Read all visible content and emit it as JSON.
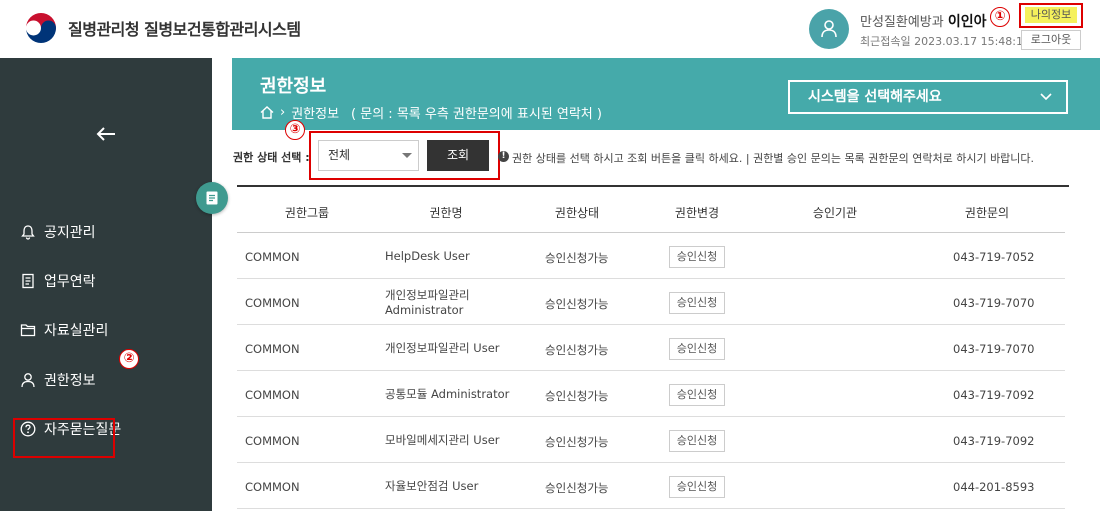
{
  "app": {
    "title": "질병관리청 질병보건통합관리시스템",
    "user_dept": "만성질환예방과",
    "user_name": "이인아",
    "last_login": "최근접속일 2023.03.17 15:48:10",
    "myinfo_label": "나의정보",
    "logout_label": "로그아웃"
  },
  "annotations": {
    "one": "①",
    "two": "②",
    "three": "③"
  },
  "sidebar": {
    "back_icon": "left-arrow-icon",
    "items": [
      {
        "label": "공지관리",
        "icon": "bell-icon"
      },
      {
        "label": "업무연락",
        "icon": "document-icon"
      },
      {
        "label": "자료실관리",
        "icon": "folder-icon"
      },
      {
        "label": "권한정보",
        "icon": "user-icon"
      },
      {
        "label": "자주묻는질문",
        "icon": "question-icon"
      }
    ]
  },
  "main": {
    "title": "권한정보",
    "breadcrumb": "권한정보",
    "breadcrumb_note": "( 문의 : 목록 우측 권한문의에 표시된 연락처 )",
    "system_select": "시스템을 선택해주세요",
    "accent_color": "#45aaaa"
  },
  "filter": {
    "label": "권한 상태 선택 :",
    "status_value": "전체",
    "search_label": "조회",
    "info_text": "권한 상태를 선택 하시고 조회 버튼을 클릭 하세요. | 권한별 승인 문의는 목록 권한문의 연락처로 하시기 바랍니다."
  },
  "table": {
    "headers": [
      "권한그룹",
      "권한명",
      "권한상태",
      "권한변경",
      "승인기관",
      "권한문의"
    ],
    "rows": [
      {
        "group": "COMMON",
        "name": "HelpDesk User",
        "status": "승인신청가능",
        "action": "승인신청",
        "org": "",
        "contact": "043-719-7052"
      },
      {
        "group": "COMMON",
        "name": "개인정보파일관리 Administrator",
        "status": "승인신청가능",
        "action": "승인신청",
        "org": "",
        "contact": "043-719-7070"
      },
      {
        "group": "COMMON",
        "name": "개인정보파일관리 User",
        "status": "승인신청가능",
        "action": "승인신청",
        "org": "",
        "contact": "043-719-7070"
      },
      {
        "group": "COMMON",
        "name": "공통모듈 Administrator",
        "status": "승인신청가능",
        "action": "승인신청",
        "org": "",
        "contact": "043-719-7092"
      },
      {
        "group": "COMMON",
        "name": "모바일메세지관리 User",
        "status": "승인신청가능",
        "action": "승인신청",
        "org": "",
        "contact": "043-719-7092"
      },
      {
        "group": "COMMON",
        "name": "자율보안점검 User",
        "status": "승인신청가능",
        "action": "승인신청",
        "org": "",
        "contact": "044-201-8593"
      }
    ]
  }
}
